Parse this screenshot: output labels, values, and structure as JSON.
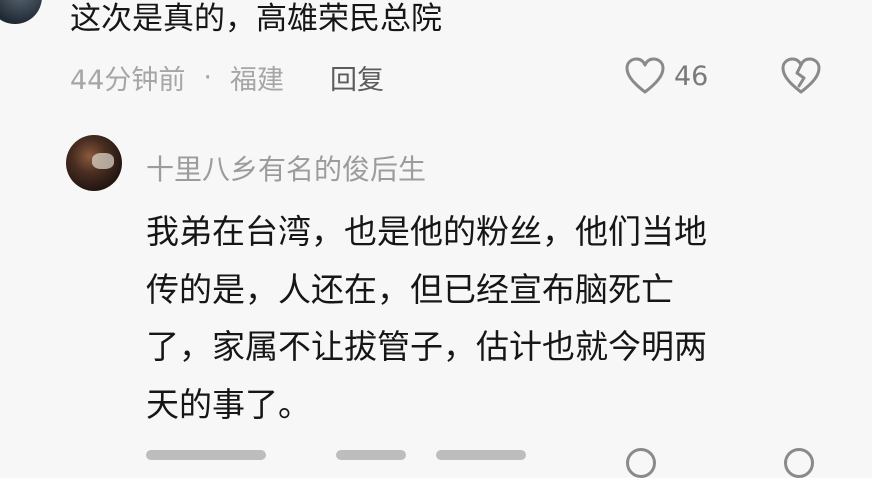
{
  "parent_comment": {
    "text": "这次是真的，高雄荣民总院",
    "time": "44分钟前",
    "separator": "·",
    "location": "福建",
    "reply_label": "回复",
    "like_count": "46"
  },
  "reply_comment": {
    "username": "十里八乡有名的俊后生",
    "body_lines": [
      "我弟在台湾，也是他的粉丝，他们当地",
      "传的是，人还在，但已经宣布脑死亡",
      "了，家属不让拔管子，估计也就今明两",
      "天的事了。"
    ]
  },
  "icons": {
    "like": "heart-outline-icon",
    "dislike": "broken-heart-icon"
  },
  "colors": {
    "text": "#161616",
    "meta": "#a6a6a6",
    "username": "#9c9c9c",
    "background": "#f7f7f7"
  }
}
